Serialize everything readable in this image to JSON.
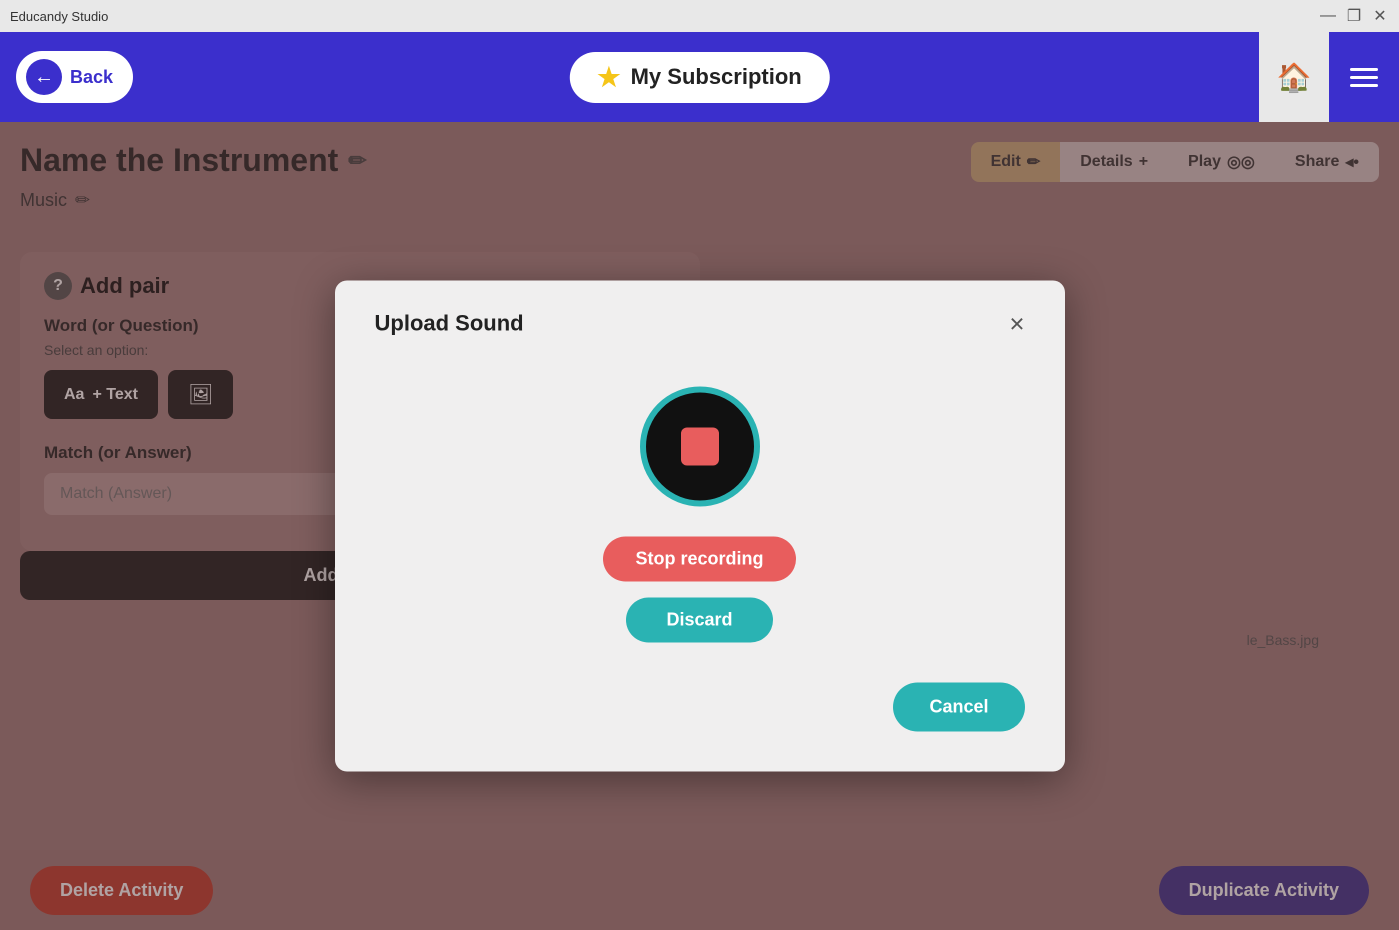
{
  "app": {
    "title": "Educandy Studio",
    "window_controls": {
      "minimize": "—",
      "maximize": "❐",
      "close": "✕"
    }
  },
  "header": {
    "back_label": "Back",
    "subscription_label": "My Subscription",
    "star_icon": "★",
    "home_icon": "⌂"
  },
  "page": {
    "activity_title": "Name the Instrument",
    "activity_subtitle": "Music",
    "edit_icon": "✏",
    "toolbar": {
      "edit_label": "Edit",
      "details_label": "Details",
      "play_label": "Play",
      "share_label": "Share"
    }
  },
  "add_pair": {
    "section_title": "Add pair",
    "word_label": "Word (or Question)",
    "select_label": "Select an option:",
    "text_btn": "+ Text",
    "text_prefix": "Aa",
    "match_label": "Match (or Answer)",
    "match_placeholder": "Match (Answer)",
    "add_pair_btn": "Add pair"
  },
  "file_ref": "le_Bass.jpg",
  "footer": {
    "delete_label": "Delete Activity",
    "duplicate_label": "Duplicate Activity"
  },
  "modal": {
    "title": "Upload Sound",
    "close_icon": "×",
    "stop_recording_label": "Stop recording",
    "discard_label": "Discard",
    "cancel_label": "Cancel"
  },
  "colors": {
    "header_bg": "#3b2fcc",
    "record_border": "#2ab3b3",
    "stop_btn": "#e85d5d",
    "teal": "#2ab3b3"
  }
}
